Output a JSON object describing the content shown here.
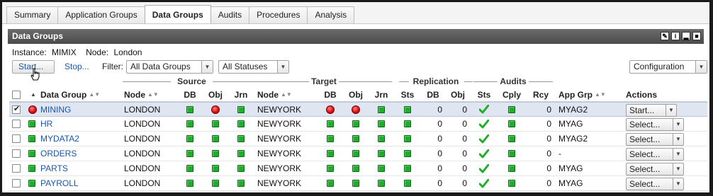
{
  "tabs": [
    {
      "label": "Summary",
      "active": false
    },
    {
      "label": "Application Groups",
      "active": false
    },
    {
      "label": "Data Groups",
      "active": true
    },
    {
      "label": "Audits",
      "active": false
    },
    {
      "label": "Procedures",
      "active": false
    },
    {
      "label": "Analysis",
      "active": false
    }
  ],
  "panel": {
    "title": "Data Groups",
    "header_icons": [
      "edit-icon",
      "info-icon",
      "minimize-icon",
      "maximize-icon"
    ]
  },
  "context": {
    "instance_label": "Instance:",
    "instance_value": "MIMIX",
    "node_label": "Node:",
    "node_value": "London"
  },
  "toolbar": {
    "start_label": "Start...",
    "stop_label": "Stop...",
    "filter_label": "Filter:",
    "group_filter": "All Data Groups",
    "status_filter": "All Statuses",
    "config_label": "Configuration"
  },
  "column_groups": {
    "source": "Source",
    "target": "Target",
    "replication": "Replication",
    "audits": "Audits"
  },
  "columns": {
    "data_group": "Data Group",
    "source_node": "Node",
    "source_db": "DB",
    "source_obj": "Obj",
    "source_jrn": "Jrn",
    "target_node": "Node",
    "target_db": "DB",
    "target_obj": "Obj",
    "target_jrn": "Jrn",
    "repl_sts": "Sts",
    "repl_db": "DB",
    "repl_obj": "Obj",
    "aud_sts": "Sts",
    "aud_cply": "Cply",
    "aud_rcy": "Rcy",
    "app_grp": "App Grp",
    "actions": "Actions"
  },
  "colors": {
    "ok_green": "#1fae2a",
    "error_red": "#e01010",
    "link_blue": "#1a56a8",
    "header_gray": "#5a5a5a",
    "selected_row": "#dfe5f1"
  },
  "rows": [
    {
      "checked": true,
      "status": "error",
      "name": "MINING",
      "source_node": "LONDON",
      "s_db": "ok",
      "s_obj": "error",
      "s_jrn": "ok",
      "target_node": "NEWYORK",
      "t_db": "error",
      "t_obj": "error",
      "t_jrn": "ok",
      "r_sts": "ok",
      "r_db": "0",
      "r_obj": "0",
      "a_sts": "check",
      "a_cply": "ok",
      "a_rcy": "0",
      "app_grp": "MYAG2",
      "action": "Start..."
    },
    {
      "checked": false,
      "status": "ok",
      "name": "HR",
      "source_node": "LONDON",
      "s_db": "ok",
      "s_obj": "ok",
      "s_jrn": "ok",
      "target_node": "NEWYORK",
      "t_db": "ok",
      "t_obj": "ok",
      "t_jrn": "ok",
      "r_sts": "ok",
      "r_db": "0",
      "r_obj": "0",
      "a_sts": "check",
      "a_cply": "ok",
      "a_rcy": "0",
      "app_grp": "MYAG",
      "action": "Select..."
    },
    {
      "checked": false,
      "status": "ok",
      "name": "MYDATA2",
      "source_node": "LONDON",
      "s_db": "ok",
      "s_obj": "ok",
      "s_jrn": "ok",
      "target_node": "NEWYORK",
      "t_db": "ok",
      "t_obj": "ok",
      "t_jrn": "ok",
      "r_sts": "ok",
      "r_db": "0",
      "r_obj": "0",
      "a_sts": "check",
      "a_cply": "ok",
      "a_rcy": "0",
      "app_grp": "MYAG2",
      "action": "Select..."
    },
    {
      "checked": false,
      "status": "ok",
      "name": "ORDERS",
      "source_node": "LONDON",
      "s_db": "ok",
      "s_obj": "ok",
      "s_jrn": "ok",
      "target_node": "NEWYORK",
      "t_db": "ok",
      "t_obj": "ok",
      "t_jrn": "ok",
      "r_sts": "ok",
      "r_db": "0",
      "r_obj": "0",
      "a_sts": "check",
      "a_cply": "ok",
      "a_rcy": "0",
      "app_grp": "-",
      "action": "Select..."
    },
    {
      "checked": false,
      "status": "ok",
      "name": "PARTS",
      "source_node": "LONDON",
      "s_db": "ok",
      "s_obj": "ok",
      "s_jrn": "ok",
      "target_node": "NEWYORK",
      "t_db": "ok",
      "t_obj": "ok",
      "t_jrn": "ok",
      "r_sts": "ok",
      "r_db": "0",
      "r_obj": "0",
      "a_sts": "check",
      "a_cply": "ok",
      "a_rcy": "0",
      "app_grp": "MYAG",
      "action": "Select..."
    },
    {
      "checked": false,
      "status": "ok",
      "name": "PAYROLL",
      "source_node": "LONDON",
      "s_db": "ok",
      "s_obj": "ok",
      "s_jrn": "ok",
      "target_node": "NEWYORK",
      "t_db": "ok",
      "t_obj": "ok",
      "t_jrn": "ok",
      "r_sts": "ok",
      "r_db": "0",
      "r_obj": "0",
      "a_sts": "check",
      "a_cply": "ok",
      "a_rcy": "0",
      "app_grp": "MYAG",
      "action": "Select..."
    }
  ]
}
